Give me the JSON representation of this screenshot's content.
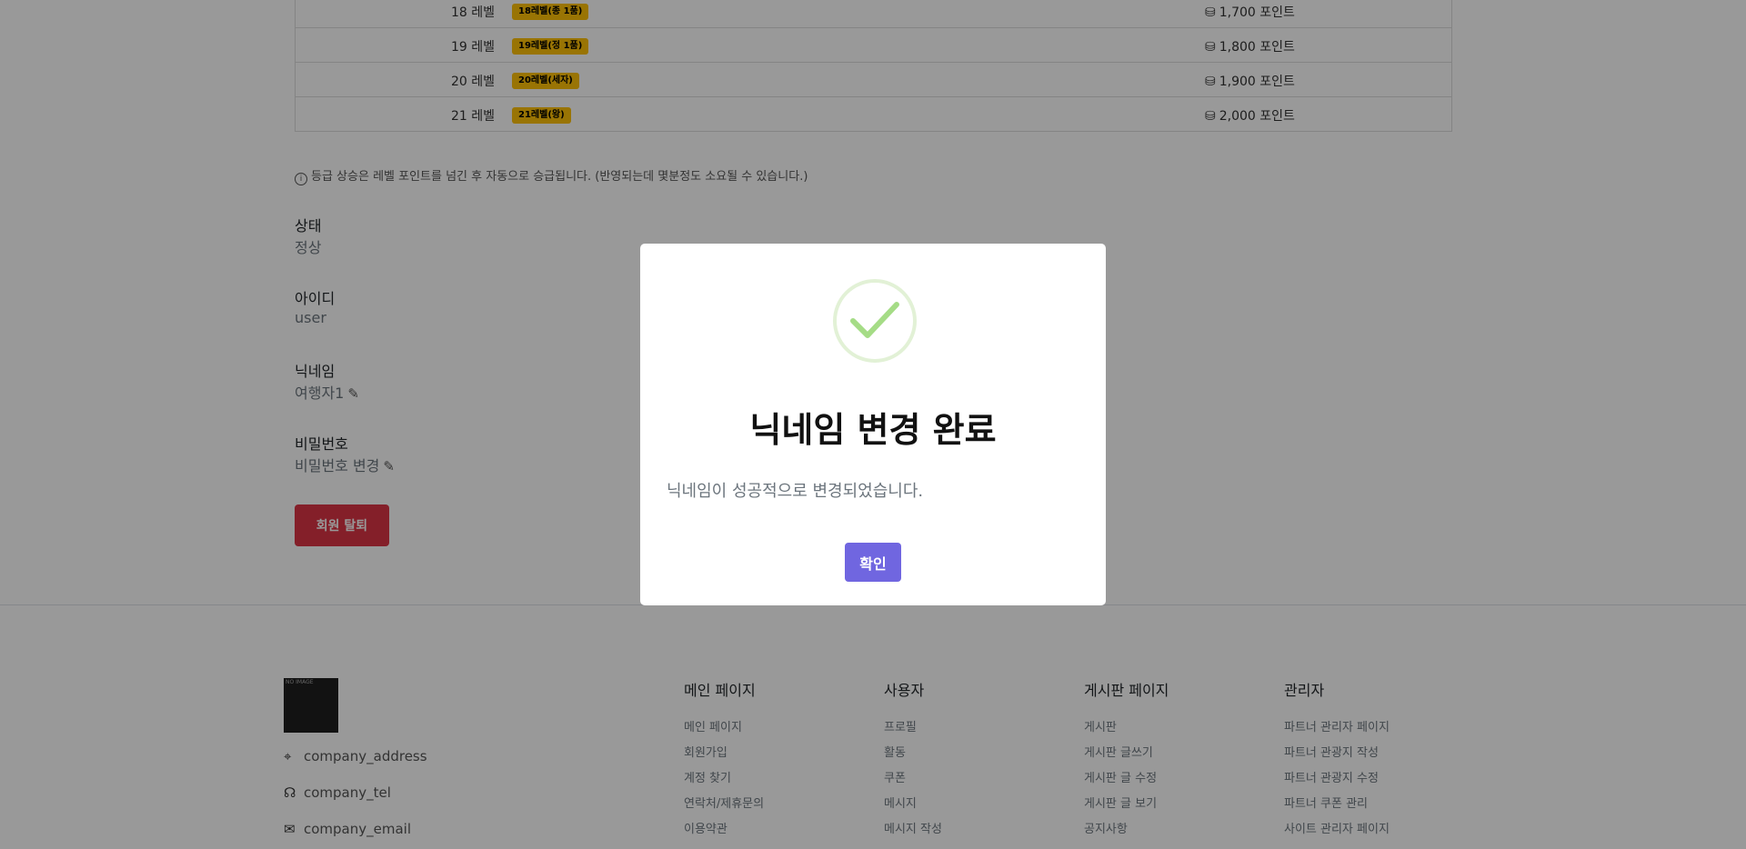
{
  "level_table": {
    "rows": [
      {
        "level": "18 레벨",
        "badge": "18레벨(종 1품)",
        "points": "1,700 포인트"
      },
      {
        "level": "19 레벨",
        "badge": "19레벨(정 1품)",
        "points": "1,800 포인트"
      },
      {
        "level": "20 레벨",
        "badge": "20레벨(세자)",
        "points": "1,900 포인트"
      },
      {
        "level": "21 레벨",
        "badge": "21레벨(왕)",
        "points": "2,000 포인트"
      }
    ],
    "coin_icon": "coins-icon",
    "note": "등급 상승은 레벨 포인트를 넘긴 후 자동으로 승급됩니다. (반영되는데 몇분정도 소요될 수 있습니다.)"
  },
  "profile": {
    "status_label": "상태",
    "status_value": "정상",
    "id_label": "아이디",
    "id_value": "user",
    "nickname_label": "닉네임",
    "nickname_value": "여행자1",
    "password_label": "비밀번호",
    "password_value": "비밀번호 변경",
    "withdraw_label": "회원 탈퇴"
  },
  "footer": {
    "logo_text": "NO IMAGE",
    "address": "company_address",
    "tel": "company_tel",
    "email": "company_email",
    "columns": [
      {
        "title": "메인 페이지",
        "links": [
          "메인 페이지",
          "회원가입",
          "계정 찾기",
          "연락처/제휴문의",
          "이용약관"
        ]
      },
      {
        "title": "사용자",
        "links": [
          "프로필",
          "활동",
          "쿠폰",
          "메시지",
          "메시지 작성"
        ]
      },
      {
        "title": "게시판 페이지",
        "links": [
          "게시판",
          "게시판 글쓰기",
          "게시판 글 수정",
          "게시판 글 보기",
          "공지사항"
        ]
      },
      {
        "title": "관리자",
        "links": [
          "파트너 관리자 페이지",
          "파트너 관광지 작성",
          "파트너 관광지 수정",
          "파트너 쿠폰 관리",
          "사이트 관리자 페이지"
        ]
      }
    ]
  },
  "modal": {
    "title": "닉네임 변경 완료",
    "text": "닉네임이 성공적으로 변경되었습니다.",
    "confirm_label": "확인",
    "icon": "check-circle-icon"
  },
  "colors": {
    "badge": "#ffc107",
    "danger": "#dc3545",
    "confirm": "#7066e0",
    "success": "#a5dc86"
  }
}
